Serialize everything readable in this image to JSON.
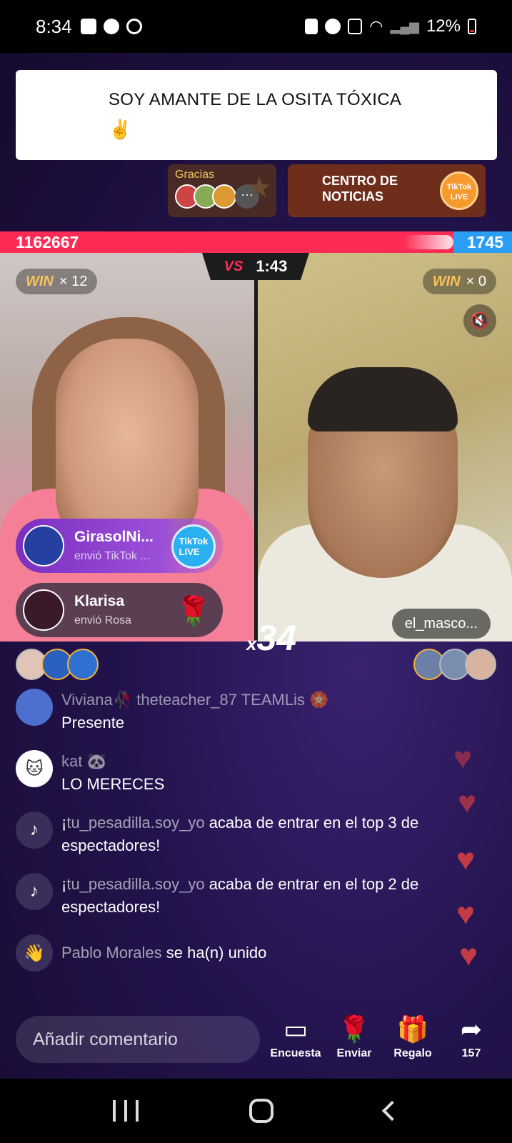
{
  "status_bar": {
    "time": "8:34",
    "battery": "12%",
    "icons": [
      "gallery-icon",
      "snapchat-icon",
      "tiktok-icon",
      "battery-saver-icon",
      "alarm-icon",
      "mute-icon",
      "wifi-icon",
      "signal-icon"
    ]
  },
  "pinned": {
    "text": "SOY  AMANTE DE LA OSITA TÓXICA",
    "emoji": "✌️"
  },
  "gracias": {
    "label": "Gracias",
    "more": "···"
  },
  "news": {
    "label_line1": "CENTRO DE",
    "label_line2": "NOTICIAS",
    "logo_text": "TikTok LIVE"
  },
  "battle": {
    "left_score": "1162667",
    "right_score": "1745",
    "vs_label": "VS",
    "timer": "1:43",
    "left_win_label": "WIN",
    "left_win_count": "× 12",
    "right_win_label": "WIN",
    "right_win_count": "× 0",
    "right_user": "el_masco...",
    "combo_x": "x",
    "combo_count": "34"
  },
  "gifts": [
    {
      "name": "GirasolNi...",
      "sub": "envió TikTok ...",
      "icon": "tiktok-live-gift-icon"
    },
    {
      "name": "Klarisa",
      "sub": "envió Rosa",
      "icon": "rose-icon"
    }
  ],
  "chat": [
    {
      "user": "Viviana🥀 theteacher_87 TEAMLis 🏵️",
      "text": "Presente",
      "avatar_icon": "user-avatar"
    },
    {
      "user": "kat 🐼",
      "text": "LO MERECES",
      "avatar_icon": "cat-avatar"
    },
    {
      "prefix": "¡",
      "user": "tu_pesadilla.soy_yo",
      "text": " acaba de entrar en el top 3 de espectadores!",
      "avatar_icon": "tiktok-icon"
    },
    {
      "prefix": "¡",
      "user": "tu_pesadilla.soy_yo",
      "text": " acaba de entrar en el top 2 de espectadores!",
      "avatar_icon": "tiktok-icon"
    },
    {
      "user": "Pablo Morales",
      "text": " se ha(n) unido",
      "avatar_icon": "wave-icon"
    }
  ],
  "bottom": {
    "comment_placeholder": "Añadir comentario",
    "poll_label": "Encuesta",
    "send_label": "Enviar",
    "gift_label": "Regalo",
    "share_count": "157"
  },
  "colors": {
    "accent_red": "#fe2c55",
    "accent_blue": "#2a9df4",
    "gold": "#f7c35a"
  }
}
